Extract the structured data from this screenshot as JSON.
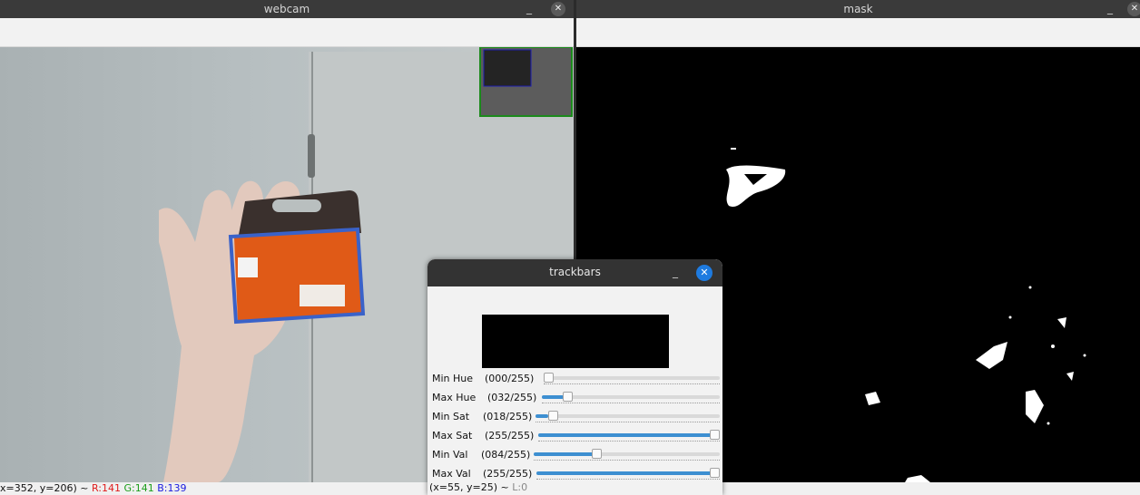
{
  "webcam": {
    "title": "webcam",
    "min_glyph": "_",
    "close_glyph": "✕",
    "status": {
      "coords": "x=352, y=206) ~ ",
      "r": "R:141",
      "g": "G:141",
      "b": "B:139"
    }
  },
  "mask": {
    "title": "mask",
    "min_glyph": "_",
    "close_glyph": "✕"
  },
  "trackbars": {
    "title": "trackbars",
    "min_glyph": "_",
    "close_glyph": "✕",
    "sliders": [
      {
        "label": "Min Hue",
        "value_text": "(000/255)",
        "value": 0,
        "max": 255
      },
      {
        "label": "Max Hue",
        "value_text": "(032/255)",
        "value": 32,
        "max": 255
      },
      {
        "label": "Min Sat",
        "value_text": "(018/255)",
        "value": 18,
        "max": 255
      },
      {
        "label": "Max Sat",
        "value_text": "(255/255)",
        "value": 255,
        "max": 255
      },
      {
        "label": "Min Val",
        "value_text": "(084/255)",
        "value": 84,
        "max": 255
      },
      {
        "label": "Max Val",
        "value_text": "(255/255)",
        "value": 255,
        "max": 255
      }
    ],
    "status": {
      "coords": "(x=55, y=25) ~ ",
      "l": "L:0"
    }
  },
  "colors": {
    "accent": "#3d8fd1",
    "close_blue": "#1e7be0",
    "red": "#e01b1b",
    "green": "#1b9e1b",
    "blue": "#1b1be0"
  }
}
